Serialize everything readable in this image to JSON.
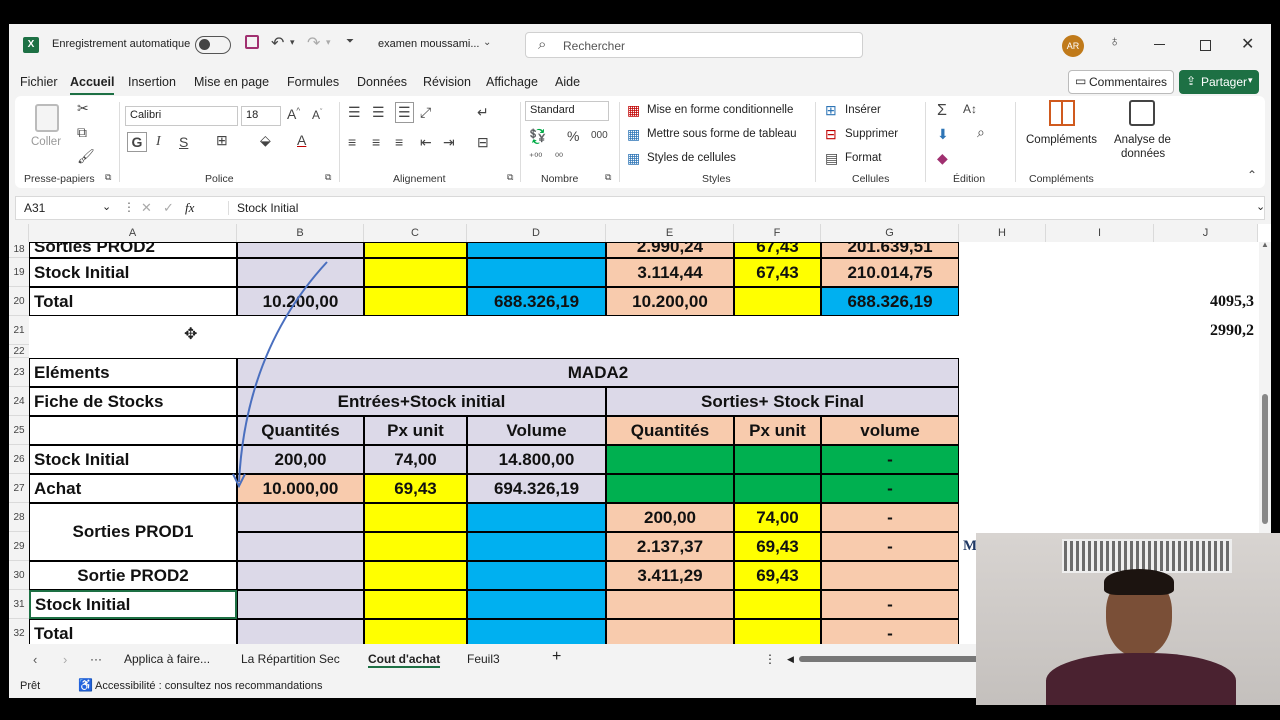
{
  "titlebar": {
    "autosave_label": "Enregistrement automatique",
    "filename": "examen moussami...",
    "search_placeholder": "Rechercher",
    "avatar": "AR"
  },
  "menu": [
    "Fichier",
    "Accueil",
    "Insertion",
    "Mise en page",
    "Formules",
    "Données",
    "Révision",
    "Affichage",
    "Aide"
  ],
  "menu_active": "Accueil",
  "comments_label": "Commentaires",
  "share_label": "Partager",
  "ribbon": {
    "paste_label": "Coller",
    "font_name": "Calibri",
    "font_size": "18",
    "number_format": "Standard",
    "cond_format": "Mise en forme conditionnelle",
    "table_format": "Mettre sous forme de tableau",
    "cell_styles": "Styles de cellules",
    "insert": "Insérer",
    "delete": "Supprimer",
    "format": "Format",
    "addins": "Compléments",
    "analyze": "Analyse de",
    "analyze2": "données",
    "groups": [
      "Presse-papiers",
      "Police",
      "Alignement",
      "Nombre",
      "Styles",
      "Cellules",
      "Édition",
      "Compléments"
    ]
  },
  "formula_bar": {
    "name_box": "A31",
    "content": "Stock Initial"
  },
  "columns": [
    "A",
    "B",
    "C",
    "D",
    "E",
    "F",
    "G",
    "H",
    "I",
    "J"
  ],
  "rows": [
    "18",
    "19",
    "20",
    "21",
    "22",
    "23",
    "24",
    "25",
    "26",
    "27",
    "28",
    "29",
    "30",
    "31",
    "32"
  ],
  "cells": {
    "a18": "Sorties PROD2",
    "e18": "2.990,24",
    "f18": "67,43",
    "g18": "201.639,51",
    "a19": "Stock Initial",
    "e19": "3.114,44",
    "f19": "67,43",
    "g19": "210.014,75",
    "a20": "Total",
    "b20": "10.200,00",
    "d20": "688.326,19",
    "e20": "10.200,00",
    "g20": "688.326,19",
    "j20": "4095,3",
    "j21": "2990,2",
    "a23": "Eléments",
    "b23": "MADA2",
    "a24": "Fiche de Stocks",
    "b24": "Entrées+Stock initial",
    "e24": "Sorties+ Stock Final",
    "b25": "Quantités",
    "c25": "Px unit",
    "d25": "Volume",
    "e25": "Quantités",
    "f25": "Px unit",
    "g25": "volume",
    "a26": "Stock Initial",
    "b26": "200,00",
    "c26": "74,00",
    "d26": "14.800,00",
    "g26": "-",
    "a27": "Achat",
    "b27": "10.000,00",
    "c27": "69,43",
    "d27": "694.326,19",
    "g27": "-",
    "a28": "Sorties PROD1",
    "e28": "200,00",
    "f28": "74,00",
    "g28": "-",
    "e29": "2.137,37",
    "f29": "69,43",
    "g29": "-",
    "h29": "M",
    "a30": "Sortie PROD2",
    "e30": "3.411,29",
    "f30": "69,43",
    "a31": "Stock Initial",
    "g31": "-",
    "a32": "Total",
    "g32": "-"
  },
  "sheets": [
    "Applica à faire...",
    "La Répartition Sec",
    "Cout d'achat",
    "Feuil3"
  ],
  "active_sheet": "Cout d'achat",
  "status": {
    "ready": "Prêt",
    "accessibility": "Accessibilité : consultez nos recommandations"
  },
  "colors": {
    "accent": "#1d7044",
    "lavender": "#dcd9e8",
    "yellow": "#ffff00",
    "cyan": "#00b0f0",
    "peach": "#f8cbad",
    "green": "#00b050"
  }
}
